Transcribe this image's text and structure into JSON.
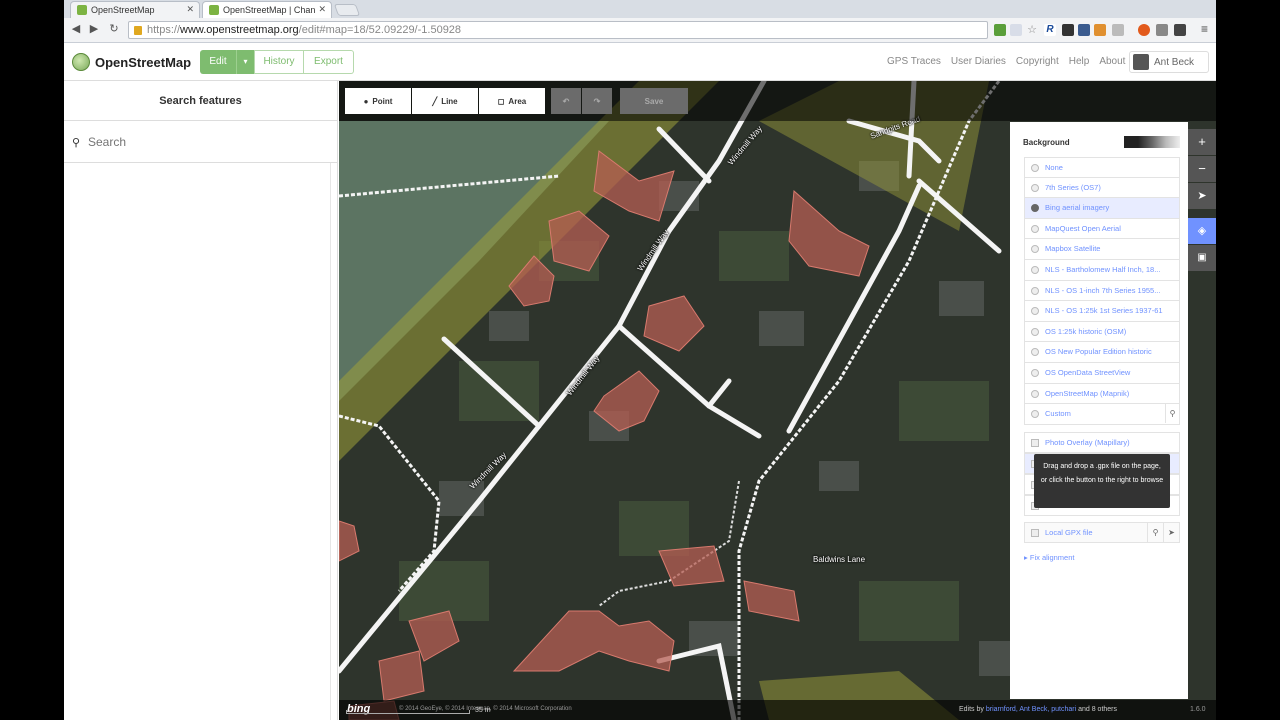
{
  "browser": {
    "tabs": [
      {
        "title": "OpenStreetMap"
      },
      {
        "title": "OpenStreetMap | Chan"
      }
    ],
    "url": {
      "protocol": "https://",
      "host": "www.openstreetmap.org",
      "path": "/edit#map=18/52.09229/-1.50928"
    }
  },
  "header": {
    "brand": "OpenStreetMap",
    "edit_label": "Edit",
    "dropdown_arrow": "▾",
    "history_label": "History",
    "export_label": "Export",
    "links": [
      "GPS Traces",
      "User Diaries",
      "Copyright",
      "Help",
      "About"
    ],
    "user": "Ant Beck"
  },
  "sidebar": {
    "title": "Search features",
    "search_placeholder": "Search"
  },
  "map_toolbar": {
    "point": "Point",
    "line": "Line",
    "area": "Area",
    "save": "Save"
  },
  "street_labels": [
    "Windmill Way",
    "Windmill Way",
    "Windmill Way",
    "Windmill Way",
    "Sandpits Road",
    "Baldwins Lane"
  ],
  "background_pane": {
    "title": "Background",
    "layers": [
      {
        "label": "None",
        "selected": false
      },
      {
        "label": "7th Series (OS7)",
        "selected": false
      },
      {
        "label": "Bing aerial imagery",
        "selected": true
      },
      {
        "label": "MapQuest Open Aerial",
        "selected": false
      },
      {
        "label": "Mapbox Satellite",
        "selected": false
      },
      {
        "label": "NLS - Bartholomew Half Inch, 18...",
        "selected": false
      },
      {
        "label": "NLS - OS 1-inch 7th Series 1955...",
        "selected": false
      },
      {
        "label": "NLS - OS 1:25k 1st Series 1937-61",
        "selected": false
      },
      {
        "label": "OS 1:25k historic (OSM)",
        "selected": false
      },
      {
        "label": "OS New Popular Edition historic",
        "selected": false
      },
      {
        "label": "OS OpenData StreetView",
        "selected": false
      },
      {
        "label": "OpenStreetMap (Mapnik)",
        "selected": false
      },
      {
        "label": "Custom",
        "selected": false
      }
    ],
    "overlay": "Photo Overlay (Mapillary)",
    "tooltip": "Drag and drop a .gpx file on the page, or click the button to the right to browse",
    "local_gpx": "Local GPX file",
    "fix_alignment": "Fix alignment"
  },
  "footer": {
    "bing": "bing",
    "attribution": "© 2014 GeoEye, © 2014 Intermap, © 2014 Microsoft Corporation",
    "scale": "35 m",
    "edits_prefix": "Edits by",
    "editors": "briarnford, Ant Beck, putchari",
    "edits_suffix": "and 8 others",
    "version": "1.6.0"
  },
  "colors": {
    "osm_green": "#7ebc6f",
    "link_blue": "#7092ff",
    "building_fill": "#c8645a",
    "landuse_yellow": "#b4b43c"
  }
}
